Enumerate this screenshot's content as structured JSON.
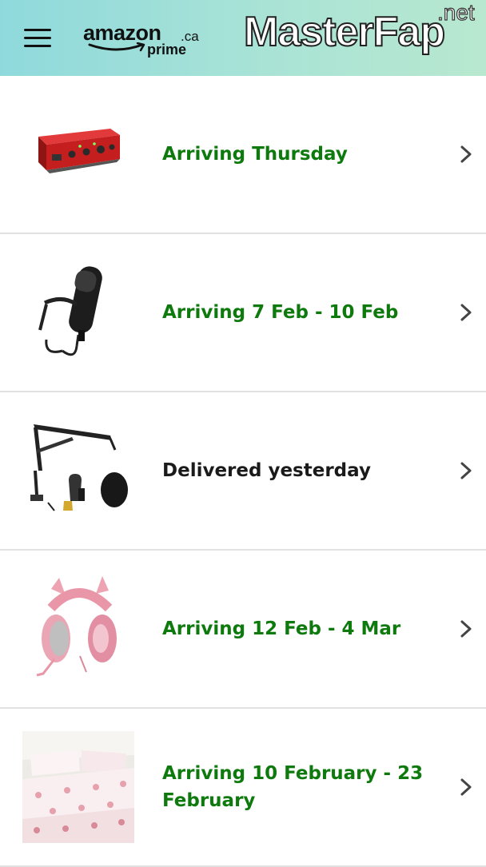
{
  "header": {
    "brand": "amazon",
    "brand_tld": ".ca",
    "brand_sub": "prime",
    "watermark": "MasterFap",
    "watermark_tld": ".net"
  },
  "orders": [
    {
      "status": "Arriving Thursday",
      "status_color": "#0e7a0e",
      "thumbnail": "audio-interface"
    },
    {
      "status": "Arriving 7 Feb - 10 Feb",
      "status_color": "#0e7a0e",
      "thumbnail": "condenser-microphone"
    },
    {
      "status": "Delivered yesterday",
      "status_color": "#1a1a1a",
      "thumbnail": "mic-boom-arm-kit"
    },
    {
      "status": "Arriving 12 Feb - 4 Mar",
      "status_color": "#0e7a0e",
      "thumbnail": "pink-cat-ear-headset"
    },
    {
      "status": "Arriving 10 February - 23 February",
      "status_color": "#0e7a0e",
      "thumbnail": "floral-bedding-set"
    }
  ]
}
